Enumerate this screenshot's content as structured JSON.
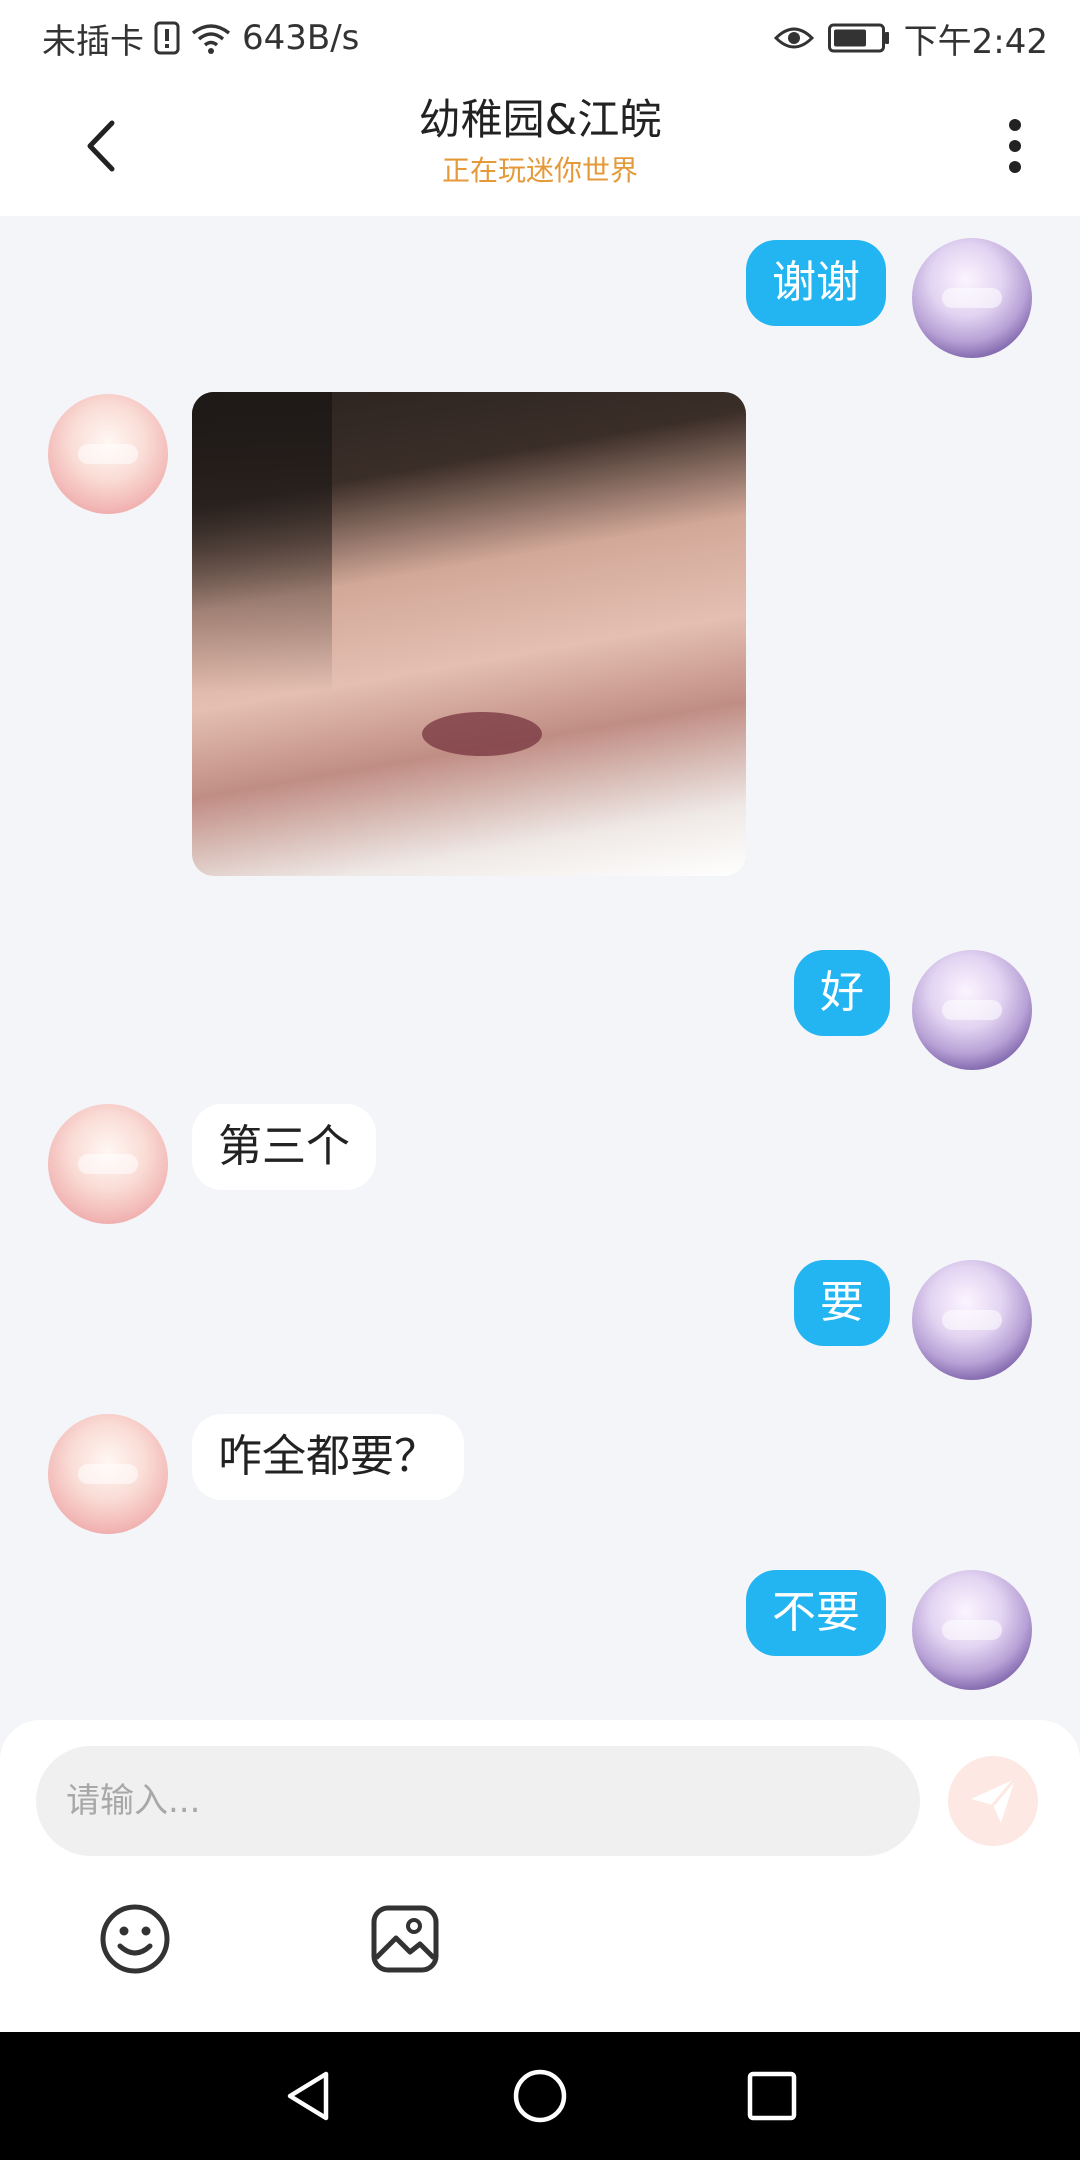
{
  "status_bar": {
    "carrier": "未插卡",
    "speed": "643B/s",
    "time": "下午2:42"
  },
  "header": {
    "title": "幼稚园&江皖",
    "subtitle": "正在玩迷你世界"
  },
  "messages": [
    {
      "from": "me",
      "text": "谢谢"
    },
    {
      "from": "other",
      "type": "image",
      "description": ""
    },
    {
      "from": "me",
      "text": "好"
    },
    {
      "from": "other",
      "text": "第三个"
    },
    {
      "from": "me",
      "text": "要"
    },
    {
      "from": "other",
      "text": "咋全都要？"
    },
    {
      "from": "me",
      "text": "不要"
    }
  ],
  "input": {
    "placeholder": "请输入..."
  },
  "colors": {
    "my_bubble": "#23b4f2",
    "subtitle": "#e59a3a",
    "send_button": "#fde8e4"
  },
  "icons": [
    "back-icon",
    "more-vertical-icon",
    "send-icon",
    "emoji-icon",
    "image-icon",
    "nav-back-icon",
    "nav-home-icon",
    "nav-recents-icon"
  ]
}
